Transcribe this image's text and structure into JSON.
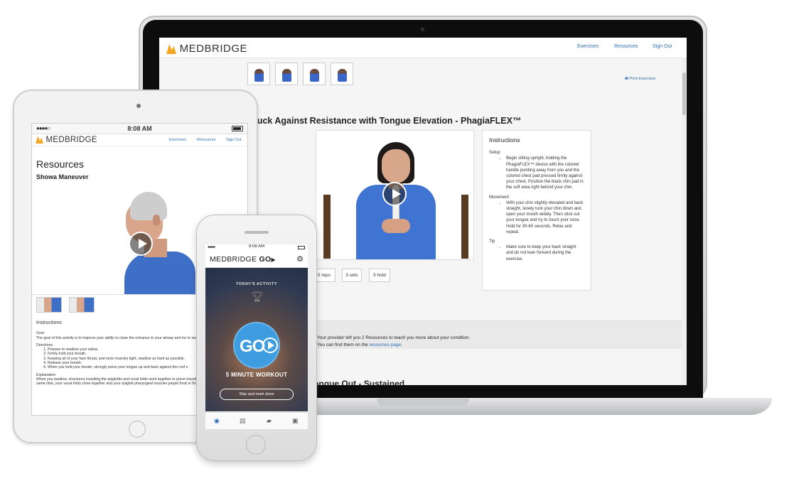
{
  "laptop": {
    "logo": "MEDBRIDGE",
    "nav": [
      "Exercises",
      "Resources",
      "Sign Out"
    ],
    "print_label": "Print Exercises",
    "exercise_title": "n Tuck Against Resistance with Tongue Elevation - PhagiaFLEX™",
    "params": [
      "10 reps",
      "3 sets",
      "5 hold"
    ],
    "instructions": {
      "heading": "Instructions",
      "setup_label": "Setup",
      "setup_text": "Begin sitting upright, holding the PhagiaFLEX™ device with the colored handle pointing away from you and the colored chest pad pressed firmly against your chest. Position the black chin pad in the soft area right behind your chin.",
      "movement_label": "Movement",
      "movement_text": "With your chin slightly elevated and back straight, slowly tuck your chin down and open your mouth widely. Then stick out your tongue and try to touch your nose. Hold for 30-60 seconds. Relax and repeat.",
      "tip_label": "Tip",
      "tip_text": "Make sure to keep your back straight and do not lean forward during the exercise."
    },
    "resources_line1": "Your provider left you 2 Resources to teach you more about your condition.",
    "resources_line2_prefix": "You can find them on the ",
    "resources_link": "resources page",
    "resources_line2_suffix": ".",
    "next_title": "n Tongue Out - Sustained"
  },
  "tablet": {
    "time": "8:08 AM",
    "signal": "●●●●○",
    "logo": "MEDBRIDGE",
    "nav": [
      "Exercises",
      "Resources",
      "Sign Out"
    ],
    "page_title": "Resources",
    "subtitle": "Showa Maneuver",
    "instructions": {
      "heading": "Instructions",
      "goal_label": "Goal",
      "goal_text": "The goal of this activity is to improve your ability to close the entrance to your airway and inc to swallow food and fluid.",
      "directions_label": "Directions",
      "directions": [
        "Prepare to swallow your saliva.",
        "Firmly hold your breath.",
        "Keeping all of your face throat, and neck muscles tight, swallow as hard as possible.",
        "Release your breath.",
        "When you hold your breath, strongly press your tongue up and back against the roof o"
      ],
      "explanation_label": "Explanation",
      "explanation_text": "When you swallow, structures including the epiglottis and vocal folds work together to preve traveling into your airway. At the same time, your vocal folds close together and your epiglott pharyngeal muscles propel food or fluid toward your stomach."
    }
  },
  "phone": {
    "time": "8:08 AM",
    "logo_main": "MEDBRIDGE",
    "logo_go": "GO",
    "todays_activity": "TODAY'S ACTIVITY",
    "go_label": "GO",
    "workout": "5 MINUTE WORKOUT",
    "skip": "Skip and mark done"
  },
  "icons": {
    "play": "play-icon",
    "gear": "gear-icon",
    "trophy": "trophy-icon",
    "printer": "printer-icon"
  },
  "colors": {
    "link_blue": "#2b6fb6",
    "go_blue": "#3d9de0",
    "brand_orange": "#f5a623"
  }
}
